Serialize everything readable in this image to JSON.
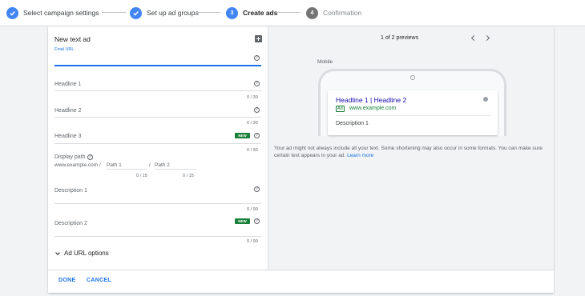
{
  "stepper": {
    "steps": [
      {
        "number": "",
        "label": "Select campaign settings",
        "state": "done"
      },
      {
        "number": "",
        "label": "Set up ad groups",
        "state": "done"
      },
      {
        "number": "3",
        "label": "Create ads",
        "state": "active"
      },
      {
        "number": "4",
        "label": "Confirmation",
        "state": "todo"
      }
    ]
  },
  "form": {
    "title": "New text ad",
    "final_url": {
      "label": "Final URL",
      "value": ""
    },
    "headline1": {
      "label": "Headline 1",
      "counter": "0 / 30"
    },
    "headline2": {
      "label": "Headline 2",
      "counter": "0 / 30"
    },
    "headline3": {
      "label": "Headline 3",
      "badge": "NEW",
      "counter": "0 / 30"
    },
    "display_path": {
      "label": "Display path",
      "domain": "www.example.com /",
      "path1": "Path 1",
      "separator": "/",
      "path2": "Path 2",
      "counter1": "0 / 15",
      "counter2": "0 / 15"
    },
    "description1": {
      "label": "Description 1",
      "counter": "0 / 90"
    },
    "description2": {
      "label": "Description 2",
      "badge": "NEW",
      "counter": "0 / 90"
    },
    "url_options": "Ad URL options"
  },
  "preview": {
    "pager": "1 of 2 previews",
    "device_label": "Mobile",
    "ad": {
      "headline": "Headline 1 | Headline 2",
      "badge": "Ad",
      "url": "www.example.com",
      "description": "Description 1"
    },
    "note": "Your ad might not always include all your text. Some shortening may also occur in some formats. You can make sure certain text appears in your ad.",
    "note_link": "Learn more"
  },
  "footer": {
    "done": "DONE",
    "cancel": "CANCEL"
  },
  "colors": {
    "accent": "#4285f4",
    "link": "#1a73e8",
    "headline": "#1a0dab",
    "green": "#188038"
  },
  "icons": {
    "step_done": "check-icon",
    "help": "help-icon",
    "add": "add-box-icon",
    "expand": "chevron-down-icon",
    "info": "info-icon"
  }
}
